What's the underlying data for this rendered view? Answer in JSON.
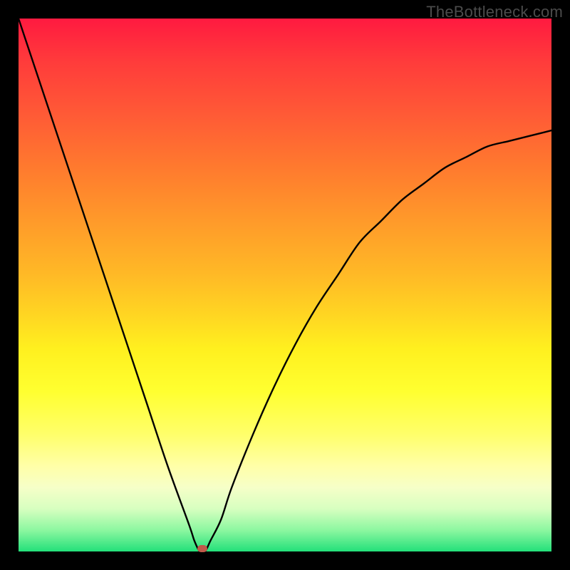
{
  "watermark": "TheBottleneck.com",
  "chart_data": {
    "type": "line",
    "title": "",
    "xlabel": "",
    "ylabel": "",
    "xlim": [
      0,
      100
    ],
    "ylim": [
      0,
      100
    ],
    "background_gradient": {
      "top_color": "#ff1a40",
      "mid_color": "#ffe622",
      "bottom_color": "#23e07a",
      "meaning": "red = high bottleneck, green = low bottleneck"
    },
    "series": [
      {
        "name": "bottleneck-curve",
        "x": [
          0,
          4,
          8,
          12,
          16,
          20,
          24,
          28,
          32,
          33,
          34,
          35,
          36,
          38,
          40,
          44,
          48,
          52,
          56,
          60,
          64,
          68,
          72,
          76,
          80,
          84,
          88,
          92,
          96,
          100
        ],
        "values": [
          100,
          88,
          76,
          64,
          52,
          40,
          28,
          16,
          5,
          2,
          0,
          0,
          2,
          6,
          12,
          22,
          31,
          39,
          46,
          52,
          58,
          62,
          66,
          69,
          72,
          74,
          76,
          77,
          78,
          79
        ]
      }
    ],
    "annotations": [
      {
        "name": "sweet-spot-marker",
        "x": 34.5,
        "y": 0.5,
        "color": "#c05a4a"
      }
    ]
  }
}
